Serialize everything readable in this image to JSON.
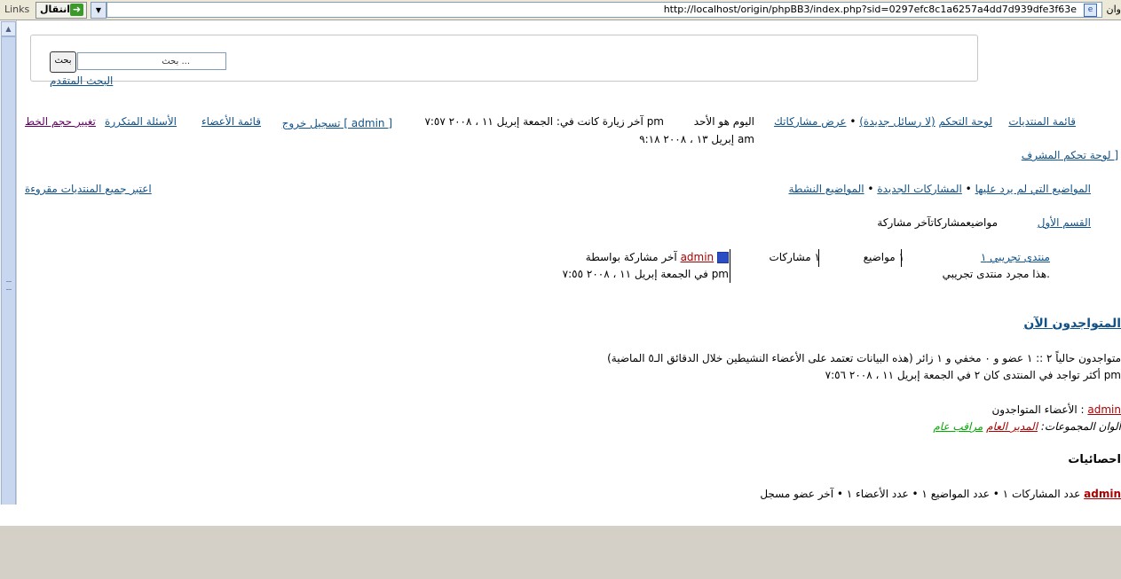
{
  "toolbar": {
    "links_label": "Links",
    "go_label": "انتقال",
    "url": "http://localhost/origin/phpBB3/index.php?sid=0297efc8c1a6257a4dd7d939dfe3f63e",
    "title_fragment": "وان"
  },
  "search": {
    "placeholder": "بحث ...",
    "button": "بحث",
    "advanced": "البحث المتقدم"
  },
  "nav": {
    "forum_list": "قائمة المنتديات",
    "control_panel": "لوحة التحكم",
    "new_messages": "(لا رسائل جديدة)",
    "bullet": "•",
    "view_posts": "عرض مشاركاتك",
    "today_line1": "اليوم هو الأحد",
    "today_line2": "إبريل ١٣ ، ٢٠٠٨ ٩:١٨ am",
    "last_visit": "آخر زيارة كانت في: الجمعة إبريل ١١ ، ٢٠٠٨ ٧:٥٧ pm",
    "logout": "تسجيل خروج [ admin ]",
    "members": "قائمة الأعضاء",
    "faq": "الأسئلة المتكررة",
    "font_size": "تغيير حجم الخط",
    "mod_panel": "لوحة تحكم المشرف ]"
  },
  "quicklinks": {
    "unanswered": "المواضيع التي لم يرد عليها",
    "new_posts": "المشاركات الجديدة",
    "active": "المواضيع النشطة",
    "mark_read": "اعتبر جميع المنتديات مقروءة"
  },
  "forum_table": {
    "category": "القسم الأول",
    "header": "مواضيعمشاركاتآخر مشاركة",
    "row": {
      "name": "منتدى تجريبي ١",
      "description": "هذا مجرد منتدى تجريبي.",
      "topics": "١ مواضيع",
      "posts": "١ مشاركات",
      "last_post_prefix": "آخر مشاركة بواسطة",
      "last_post_user": "admin",
      "last_post_date": "في الجمعة إبريل ١١ ، ٢٠٠٨ ٧:٥٥ pm"
    }
  },
  "online": {
    "heading": "المتواجدون الآن",
    "line1": "متواجدون حالياً ٢ :: ١ عضو و ٠ مخفي و ١ زائر (هذه البيانات تعتمد على الأعضاء النشيطين خلال الدقائق الـ٥ الماضية)",
    "line2": "أكثر تواجد في المنتدى كان ٢ في الجمعة إبريل ١١ ، ٢٠٠٨ ٧:٥٦ pm",
    "members_label": "الأعضاء المتواجدون :",
    "members_user": "admin",
    "legend_label": "ألوان المجموعات:",
    "group_admin": "المدير العام",
    "group_mod": "مراقب عام"
  },
  "stats": {
    "heading": "احصائيات",
    "line": "عدد المشاركات ١ • عدد المواضيع ١ • عدد الأعضاء ١ • آخر عضو مسجل",
    "newest_user": "admin"
  },
  "colors": {
    "link": "#105289",
    "user_admin": "#aa0000",
    "group_mod": "#00aa00"
  }
}
